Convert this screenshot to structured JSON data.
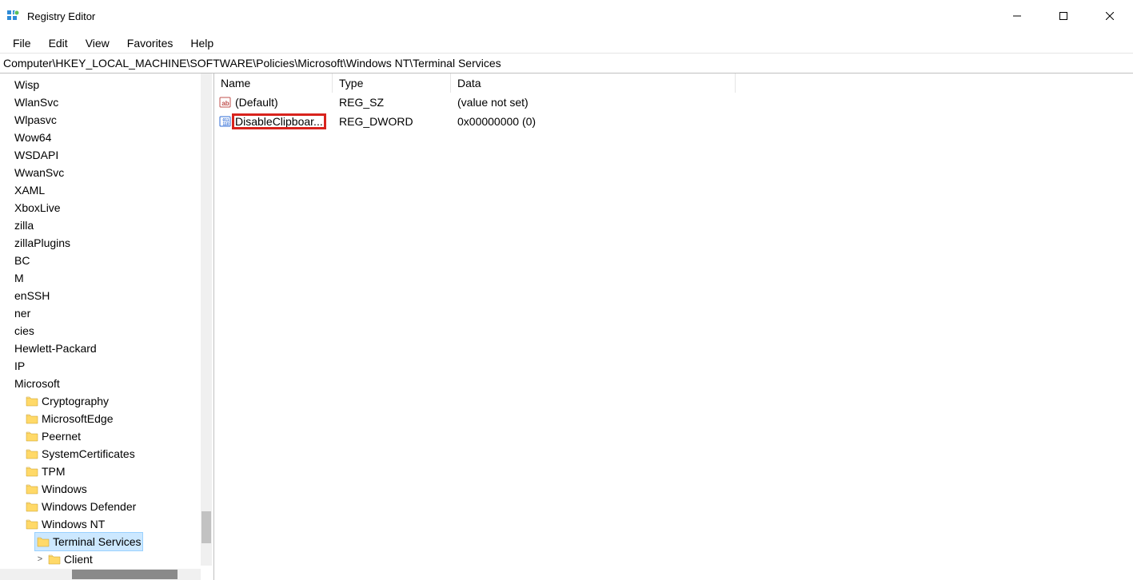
{
  "window": {
    "title": "Registry Editor"
  },
  "menu": {
    "file": "File",
    "edit": "Edit",
    "view": "View",
    "favorites": "Favorites",
    "help": "Help"
  },
  "address": "Computer\\HKEY_LOCAL_MACHINE\\SOFTWARE\\Policies\\Microsoft\\Windows NT\\Terminal Services",
  "tree": {
    "items": [
      {
        "label": "Wisp",
        "indent": 0,
        "folder": false
      },
      {
        "label": "WlanSvc",
        "indent": 0,
        "folder": false
      },
      {
        "label": "Wlpasvc",
        "indent": 0,
        "folder": false
      },
      {
        "label": "Wow64",
        "indent": 0,
        "folder": false
      },
      {
        "label": "WSDAPI",
        "indent": 0,
        "folder": false
      },
      {
        "label": "WwanSvc",
        "indent": 0,
        "folder": false
      },
      {
        "label": "XAML",
        "indent": 0,
        "folder": false
      },
      {
        "label": "XboxLive",
        "indent": 0,
        "folder": false
      },
      {
        "label": "zilla",
        "indent": 0,
        "folder": false
      },
      {
        "label": "zillaPlugins",
        "indent": 0,
        "folder": false
      },
      {
        "label": "BC",
        "indent": 0,
        "folder": false
      },
      {
        "label": "M",
        "indent": 0,
        "folder": false
      },
      {
        "label": "enSSH",
        "indent": 0,
        "folder": false
      },
      {
        "label": "ner",
        "indent": 0,
        "folder": false
      },
      {
        "label": "cies",
        "indent": 0,
        "folder": false
      },
      {
        "label": "Hewlett-Packard",
        "indent": 0,
        "folder": false
      },
      {
        "label": "IP",
        "indent": 0,
        "folder": false
      },
      {
        "label": "Microsoft",
        "indent": 0,
        "folder": false
      },
      {
        "label": "Cryptography",
        "indent": 1,
        "folder": true
      },
      {
        "label": "MicrosoftEdge",
        "indent": 1,
        "folder": true
      },
      {
        "label": "Peernet",
        "indent": 1,
        "folder": true
      },
      {
        "label": "SystemCertificates",
        "indent": 1,
        "folder": true
      },
      {
        "label": "TPM",
        "indent": 1,
        "folder": true
      },
      {
        "label": "Windows",
        "indent": 1,
        "folder": true
      },
      {
        "label": "Windows Defender",
        "indent": 1,
        "folder": true
      },
      {
        "label": "Windows NT",
        "indent": 1,
        "folder": true
      },
      {
        "label": "Terminal Services",
        "indent": 2,
        "folder": true,
        "selected": true
      },
      {
        "label": "Client",
        "indent": 3,
        "folder": true,
        "chevron": ">"
      }
    ]
  },
  "list": {
    "headers": {
      "name": "Name",
      "type": "Type",
      "data": "Data"
    },
    "rows": [
      {
        "icon": "string",
        "name": "(Default)",
        "type": "REG_SZ",
        "data": "(value not set)",
        "highlight": false
      },
      {
        "icon": "dword",
        "name": "DisableClipboar...",
        "type": "REG_DWORD",
        "data": "0x00000000 (0)",
        "highlight": true
      }
    ]
  }
}
